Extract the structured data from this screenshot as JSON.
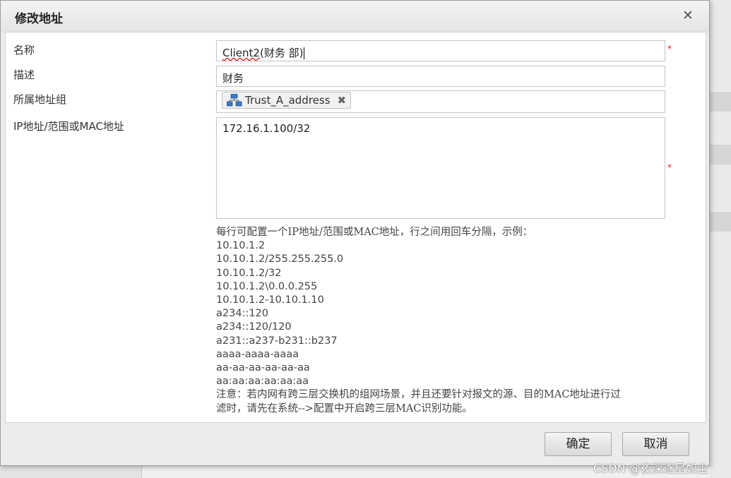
{
  "dialog": {
    "title": "修改地址",
    "close_glyph": "✕"
  },
  "form": {
    "name": {
      "label": "名称",
      "value_prefix": "Client2",
      "value_rest": "(财务 部)",
      "required_mark": "*"
    },
    "description": {
      "label": "描述",
      "value": "财务"
    },
    "address_group": {
      "label": "所属地址组",
      "tag": "Trust_A_address",
      "tag_remove_glyph": "✖",
      "tag_icon": "network-group-icon"
    },
    "ip_address": {
      "label": "IP地址/范围或MAC地址",
      "value": "172.16.1.100/32",
      "required_mark": "*"
    },
    "help": {
      "intro": "每行可配置一个IP地址/范围或MAC地址，行之间用回车分隔，示例：",
      "examples": [
        "10.10.1.2",
        "10.10.1.2/255.255.255.0",
        "10.10.1.2/32",
        "10.10.1.2\\0.0.0.255",
        "10.10.1.2-10.10.1.10",
        "a234::120",
        "a234::120/120",
        "a231::a237-b231::b237",
        "aaaa-aaaa-aaaa",
        "aa-aa-aa-aa-aa-aa",
        "aa:aa:aa:aa:aa:aa"
      ],
      "note_line1": "注意：若内网有跨三层交换机的组网场景，并且还要针对报文的源、目的MAC地址进行过",
      "note_line2": "滤时，请先在系统-->配置中开启跨三层MAC识别功能。"
    }
  },
  "buttons": {
    "ok": "确定",
    "cancel": "取消"
  },
  "watermark": "CSDN @夜深逐星如尘",
  "colors": {
    "required": "#e02020",
    "tag_icon_blue": "#3a78c4"
  }
}
